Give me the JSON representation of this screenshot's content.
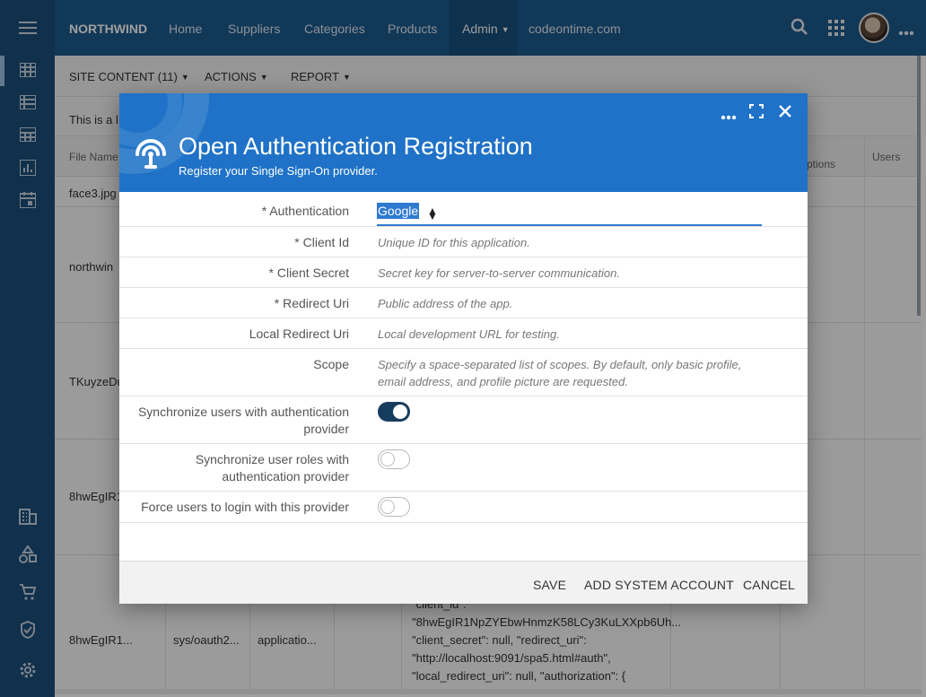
{
  "topbar": {
    "brand": "NORTHWIND",
    "nav": [
      "Home",
      "Suppliers",
      "Categories",
      "Products",
      "Admin",
      "codeontime.com"
    ]
  },
  "toolbar": {
    "site_content": "SITE CONTENT (11)",
    "actions": "ACTIONS",
    "report": "REPORT"
  },
  "background": {
    "info": "This is a l",
    "col_file_name": "File Name",
    "col_options": "ptions",
    "col_users": "Users",
    "rows": [
      "face3.jpg",
      "northwin",
      "TKuyzeDu",
      "8hwEgIR1",
      "8hwEgIR1..."
    ],
    "row5_path": "sys/oauth2...",
    "row5_type": "applicatio...",
    "json_lines": [
      "\"client_id\":",
      "\"8hwEgIR1NpZYEbwHnmzK58LCy3KuLXXpb6Uh...",
      "\"client_secret\": null, \"redirect_uri\":",
      "\"http://localhost:9091/spa5.html#auth\",",
      "\"local_redirect_uri\": null, \"authorization\": {"
    ]
  },
  "modal": {
    "title": "Open Authentication Registration",
    "subtitle": "Register your Single Sign-On provider.",
    "fields": {
      "authentication_label": "* Authentication",
      "authentication_value": "Google",
      "client_id_label": "* Client Id",
      "client_id_placeholder": "Unique ID for this application.",
      "client_secret_label": "* Client Secret",
      "client_secret_placeholder": "Secret key for server-to-server communication.",
      "redirect_uri_label": "* Redirect Uri",
      "redirect_uri_placeholder": "Public address of the app.",
      "local_redirect_label": "Local Redirect Uri",
      "local_redirect_placeholder": "Local development URL for testing.",
      "scope_label": "Scope",
      "scope_placeholder_1": "Specify a space-separated list of scopes. By default, only basic profile,",
      "scope_placeholder_2": "email address, and profile picture are requested.",
      "sync_users_label_1": "Synchronize users with authentication",
      "sync_users_label_2": "provider",
      "sync_users_on": true,
      "sync_roles_label_1": "Synchronize user roles with",
      "sync_roles_label_2": "authentication provider",
      "sync_roles_on": false,
      "force_login_label": "Force users to login with this provider",
      "force_login_on": false
    },
    "buttons": {
      "save": "SAVE",
      "add_system_account": "ADD SYSTEM ACCOUNT",
      "cancel": "CANCEL"
    }
  },
  "colors": {
    "topbar": "#1d5b8f",
    "rail": "#1b4e7a",
    "modal_header": "#1f72c7",
    "toggle_on": "#173d5e"
  }
}
